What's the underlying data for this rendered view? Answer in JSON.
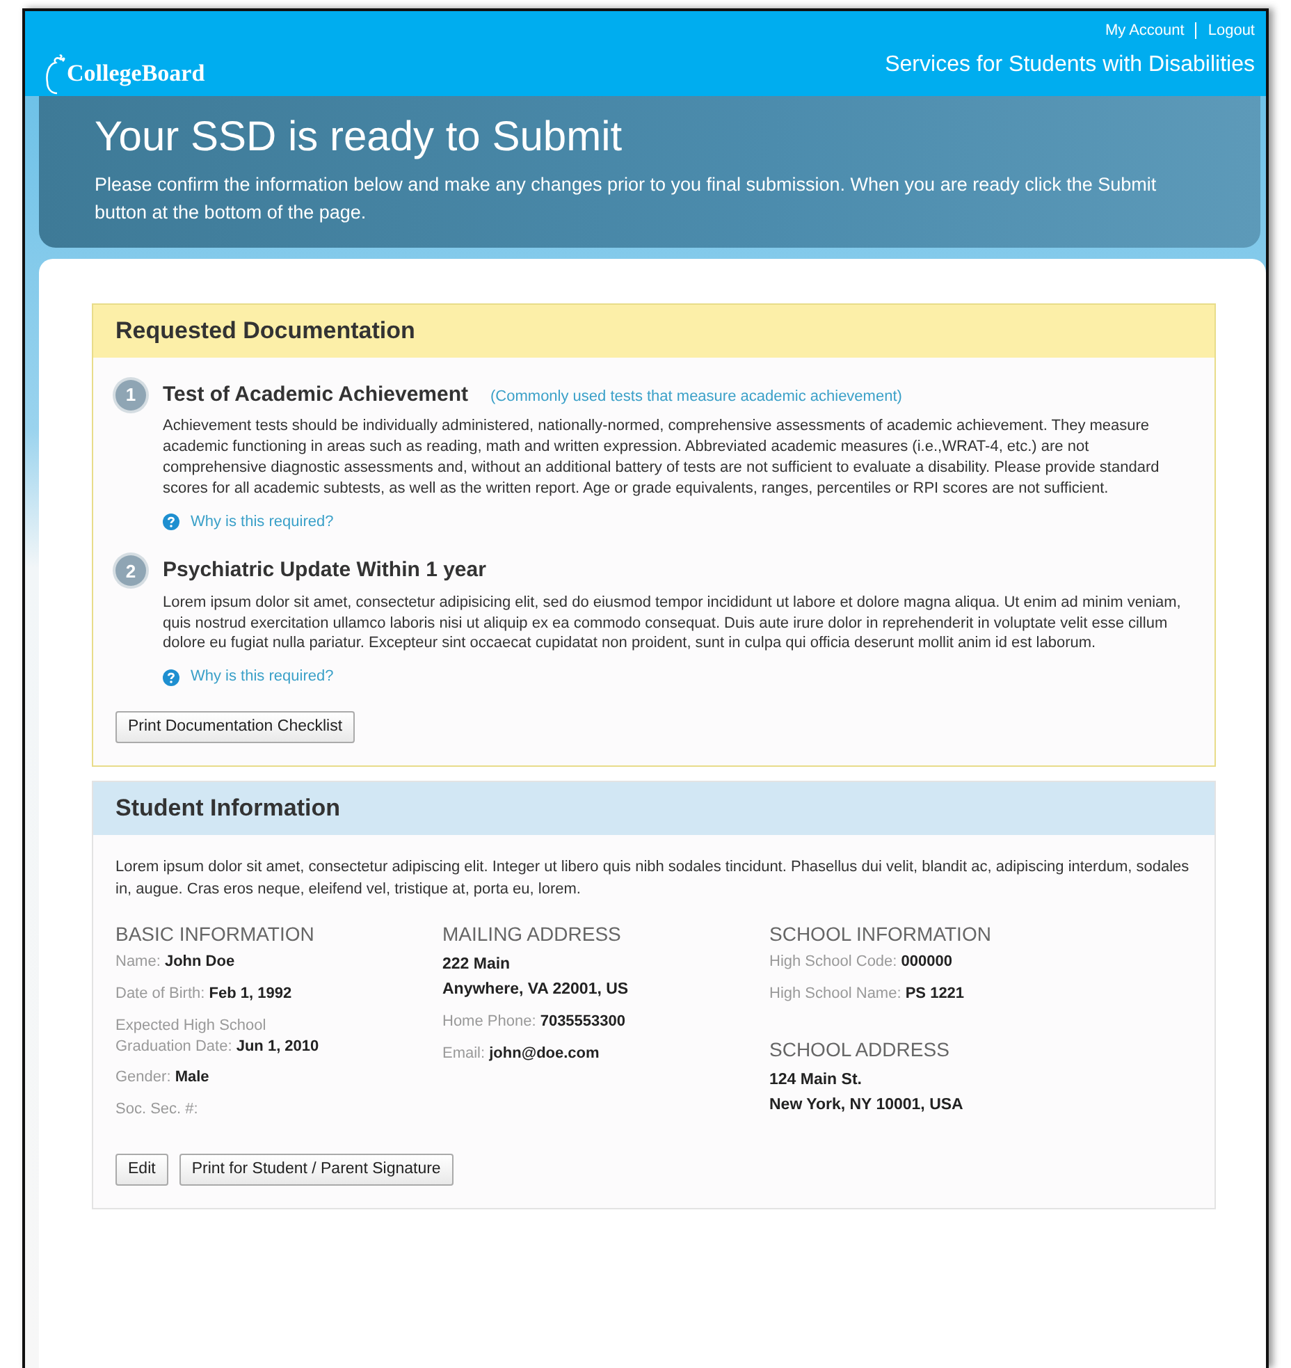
{
  "header": {
    "logo": "CollegeBoard",
    "links": [
      "My Account",
      "Logout"
    ],
    "subtitle": "Services for Students with Disabilities"
  },
  "hero": {
    "title": "Your SSD is ready to Submit",
    "text": "Please confirm the information below and make any changes prior to you final submission. When you are ready click the Submit button at the bottom of the page."
  },
  "documentation": {
    "heading": "Requested Documentation",
    "items": [
      {
        "number": "1",
        "title": "Test of Academic Achievement",
        "link": "(Commonly used tests that measure academic achievement)",
        "body": "Achievement tests should be individually administered, nationally-normed, comprehensive assessments of academic achievement. They measure academic functioning in areas such as reading, math and written expression. Abbreviated academic measures (i.e.,WRAT-4, etc.) are not comprehensive diagnostic assessments and, without an additional battery of tests are not sufficient to evaluate a disability. Please provide standard scores for all academic subtests, as well as the written report. Age or grade equivalents, ranges, percentiles or RPI scores are not sufficient.",
        "help": "Why is this required?"
      },
      {
        "number": "2",
        "title": "Psychiatric Update Within 1 year",
        "body": "Lorem ipsum dolor sit amet, consectetur adipisicing elit, sed do eiusmod tempor incididunt ut labore et dolore magna aliqua. Ut enim ad minim veniam, quis nostrud exercitation ullamco laboris nisi ut aliquip ex ea commodo consequat. Duis aute irure dolor in reprehenderit in voluptate velit esse cillum dolore eu fugiat nulla pariatur. Excepteur sint occaecat cupidatat non proident, sunt in culpa qui officia deserunt mollit anim id est laborum.",
        "help": "Why is this required?"
      }
    ],
    "button": "Print Documentation Checklist"
  },
  "student": {
    "heading": "Student Information",
    "intro": "Lorem ipsum dolor sit amet, consectetur adipiscing elit. Integer ut libero quis nibh sodales tincidunt. Phasellus dui velit, blandit ac, adipiscing interdum, sodales in, augue. Cras eros neque, eleifend vel, tristique at, porta eu, lorem.",
    "columns": [
      {
        "blocks": [
          {
            "heading": "BASIC INFORMATION",
            "fields": [
              {
                "label": "Name:",
                "value": "John Doe"
              },
              {
                "label": "Date of Birth:",
                "value": "Feb 1, 1992"
              },
              {
                "label": "Expected High School Graduation Date:",
                "value": "Jun 1, 2010"
              },
              {
                "label": "Gender:",
                "value": "Male"
              },
              {
                "label": "Soc. Sec. #:"
              }
            ]
          }
        ]
      },
      {
        "blocks": [
          {
            "heading": "MAILING ADDRESS",
            "lines": [
              "222 Main",
              "Anywhere, VA 22001, US"
            ],
            "fields": [
              {
                "label": "Home Phone:",
                "value": "7035553300"
              },
              {
                "label": "Email:",
                "value": "john@doe.com"
              }
            ]
          }
        ]
      },
      {
        "blocks": [
          {
            "heading": "SCHOOL INFORMATION",
            "fields": [
              {
                "label": "High School Code:",
                "value": "000000"
              },
              {
                "label": "High School Name:",
                "value": "PS 1221"
              }
            ]
          },
          {
            "heading": "SCHOOL ADDRESS",
            "lines": [
              "124 Main St.",
              "New York, NY 10001, USA"
            ]
          }
        ]
      }
    ],
    "buttons": [
      "Edit",
      "Print for Student / Parent Signature"
    ]
  }
}
